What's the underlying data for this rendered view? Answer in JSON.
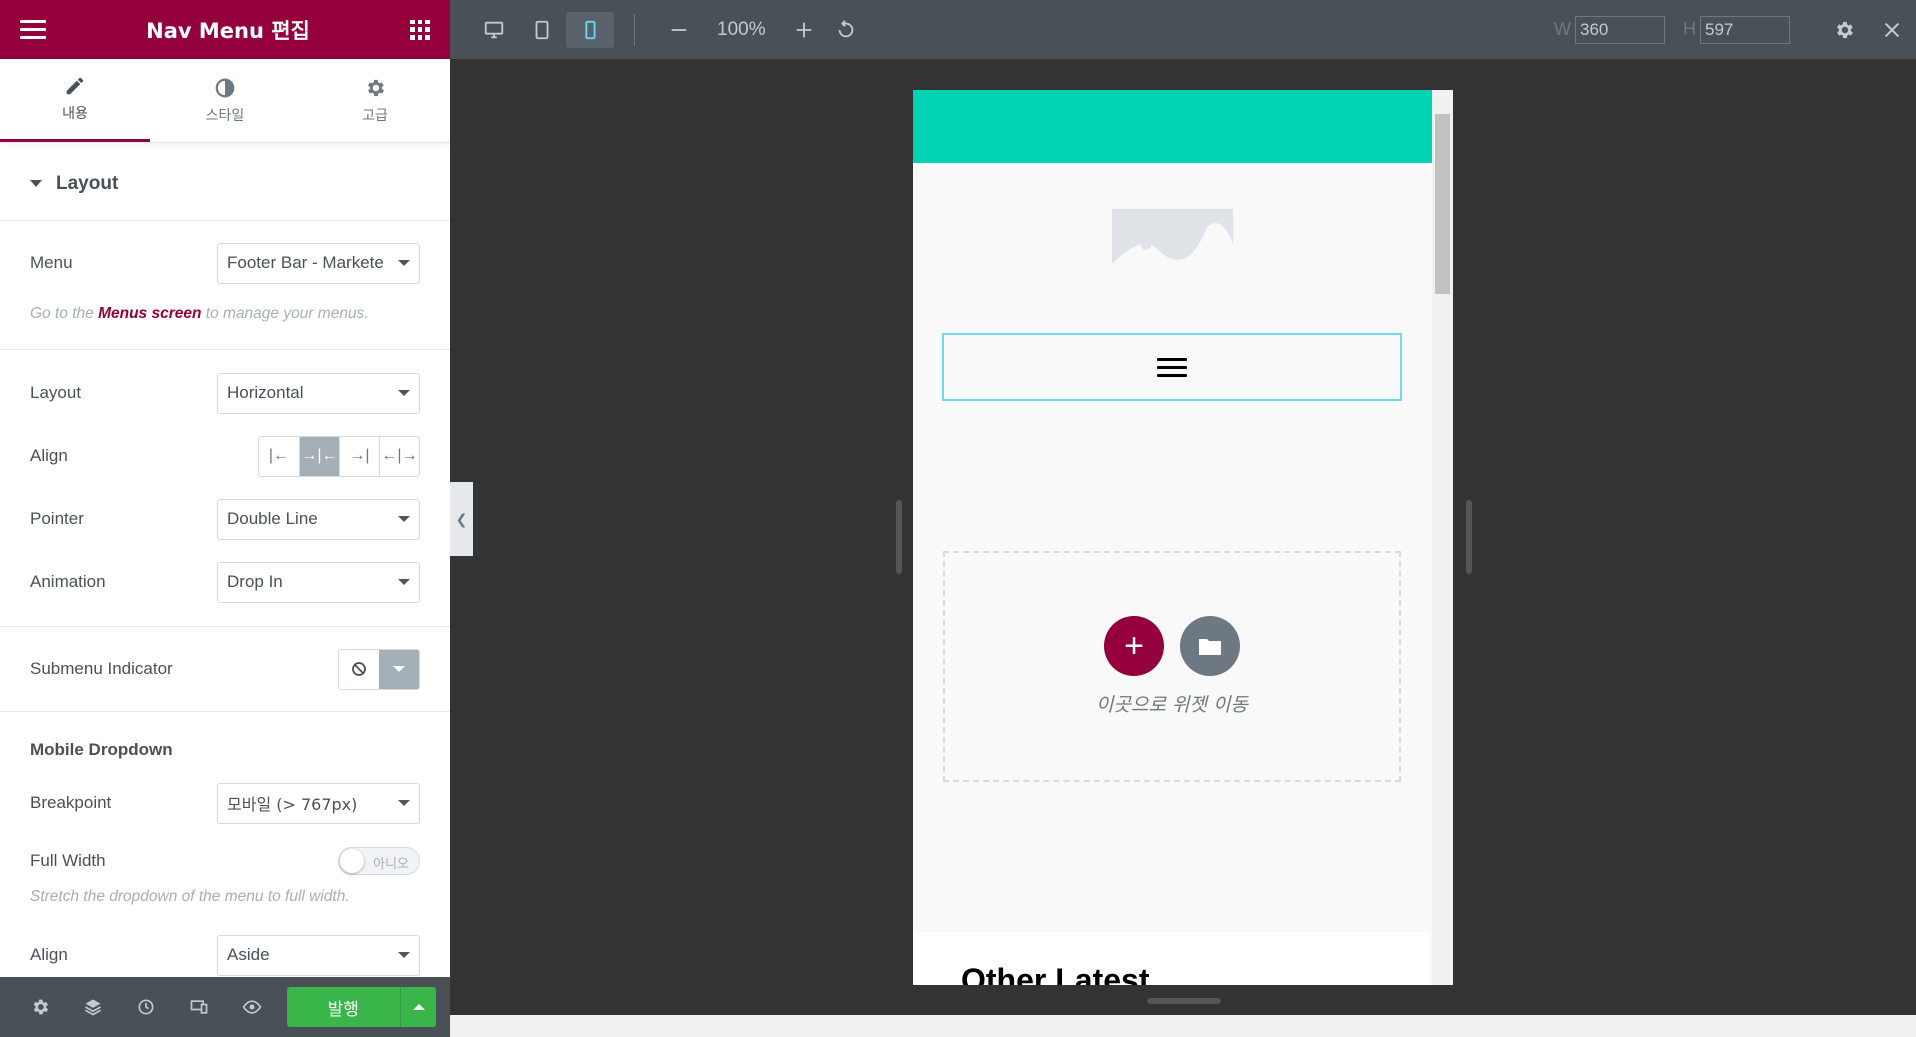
{
  "header": {
    "title": "Nav Menu 편집"
  },
  "tabs": [
    {
      "label": "내용",
      "active": true
    },
    {
      "label": "스타일",
      "active": false
    },
    {
      "label": "고급",
      "active": false
    }
  ],
  "section": {
    "title": "Layout"
  },
  "fields": {
    "menu": {
      "label": "Menu",
      "value": "Footer Bar - Markete"
    },
    "menu_hint": {
      "prefix": "Go to the ",
      "link": "Menus screen",
      "suffix": " to manage your menus."
    },
    "layout": {
      "label": "Layout",
      "value": "Horizontal"
    },
    "align": {
      "label": "Align"
    },
    "pointer": {
      "label": "Pointer",
      "value": "Double Line"
    },
    "animation": {
      "label": "Animation",
      "value": "Drop In"
    },
    "submenu_indicator": {
      "label": "Submenu Indicator"
    },
    "mobile_dropdown": {
      "label": "Mobile Dropdown"
    },
    "breakpoint": {
      "label": "Breakpoint",
      "value": "모바일 (> 767px)"
    },
    "full_width": {
      "label": "Full Width",
      "toggle_label": "아니오"
    },
    "full_width_hint": {
      "text": "Stretch the dropdown of the menu to full width."
    },
    "align2": {
      "label": "Align",
      "value": "Aside"
    }
  },
  "footer": {
    "publish_label": "발행"
  },
  "topbar": {
    "zoom": "100%",
    "w_label": "W",
    "w_value": "360",
    "h_label": "H",
    "h_value": "597"
  },
  "canvas": {
    "dropzone_text": "이곳으로 위젯 이동",
    "partial_heading": "Other Latest"
  },
  "colors": {
    "brand": "#93003c",
    "teal": "#00d2b4",
    "publish": "#39b54a"
  }
}
